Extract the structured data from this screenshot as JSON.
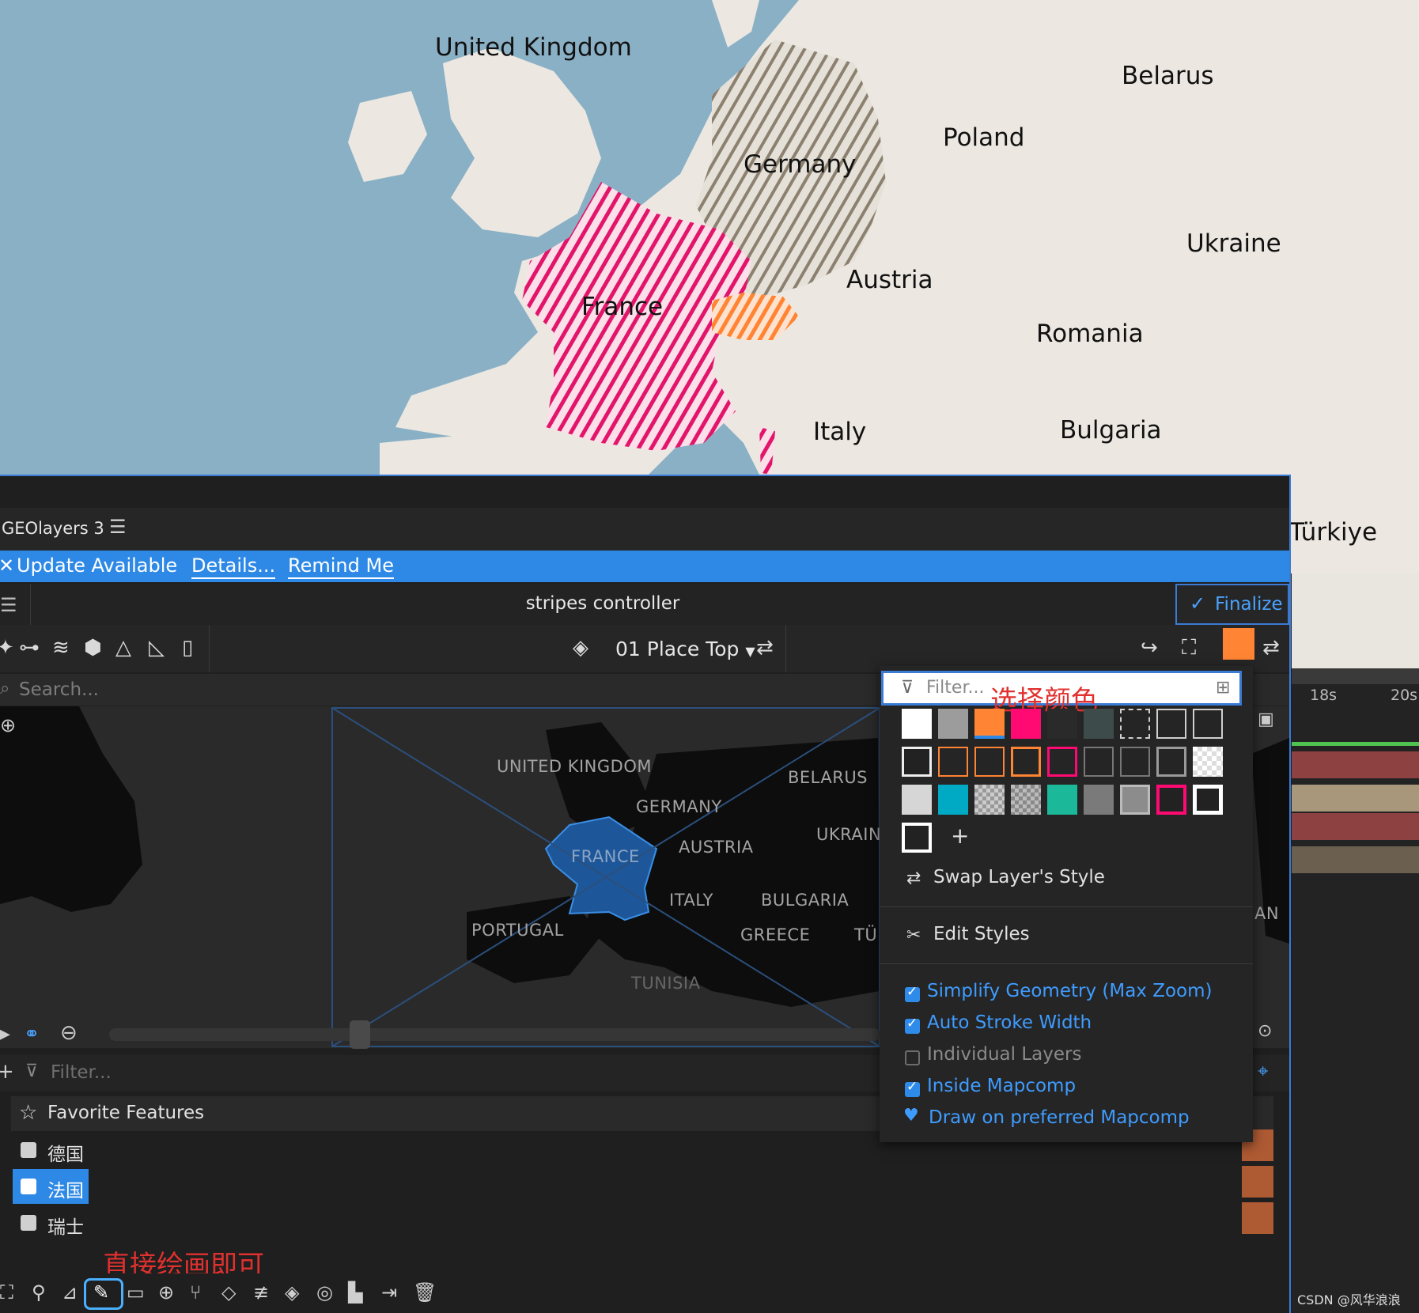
{
  "background_map": {
    "labels": {
      "uk": "United Kingdom",
      "belarus": "Belarus",
      "poland": "Poland",
      "germany": "Germany",
      "ukraine": "Ukraine",
      "austria": "Austria",
      "france": "France",
      "romania": "Romania",
      "italy": "Italy",
      "bulgaria": "Bulgaria",
      "turkiye": "Türkiye"
    },
    "colors": {
      "sea": "#8ab0c6",
      "land": "#ece8e1",
      "france": "#e2156a",
      "germany": "#8c8170",
      "swiss": "#ff8433"
    }
  },
  "window": {
    "panel_title": "GEOlayers 3",
    "menu_glyph": "☰",
    "update": {
      "close": "✕",
      "text": "Update Available",
      "details": "Details...",
      "remind": "Remind Me"
    },
    "controller_name": "stripes controller",
    "finalize_label": "Finalize",
    "style_name": "01 Place Top",
    "search_placeholder": "Search...",
    "preview_labels": {
      "uk": "UNITED KINGDOM",
      "belarus": "BELARUS",
      "germany": "GERMANY",
      "ukraine": "UKRAINI",
      "france": "FRANCE",
      "austria": "AUSTRIA",
      "italy": "ITALY",
      "bulgaria": "BULGARIA",
      "portugal": "PORTUGAL",
      "greece": "GREECE",
      "turkey": "TÜ",
      "tunisia": "TUNISIA",
      "an": "AN"
    },
    "filter_placeholder": "Filter...",
    "favorites": {
      "title": "Favorite Features",
      "items": [
        {
          "label": "德国",
          "selected": false
        },
        {
          "label": "法国",
          "selected": true
        },
        {
          "label": "瑞士",
          "selected": false
        }
      ]
    },
    "annotation_draw": "直接绘画即可",
    "accent": "#ff8433"
  },
  "popover": {
    "filter_placeholder": "Filter...",
    "annotation_color": "选择颜色",
    "add_label": "+",
    "swap_label": "Swap Layer's Style",
    "edit_label": "Edit Styles",
    "options": [
      {
        "label": "Simplify Geometry (Max Zoom)",
        "checked": true
      },
      {
        "label": "Auto Stroke Width",
        "checked": true
      },
      {
        "label": "Individual Layers",
        "checked": false
      },
      {
        "label": "Inside Mapcomp",
        "checked": true
      }
    ],
    "preferred_label": "Draw on preferred Mapcomp"
  },
  "timeline": {
    "ticks": [
      "18s",
      "20s"
    ]
  },
  "watermark": "CSDN @风华浪浪"
}
